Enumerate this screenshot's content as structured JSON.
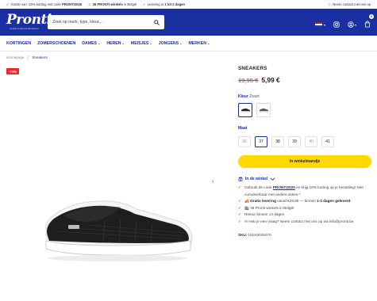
{
  "topbar": {
    "items": [
      {
        "pre": "Gratis! van -10% korting met code ",
        "bold": "PRONTI2026",
        "post": ""
      },
      {
        "pre": "",
        "bold": "36 PRONTI-winkels",
        "post": " in België"
      },
      {
        "pre": "Levering in ",
        "bold": "1 tot 2 dagen",
        "post": ""
      }
    ],
    "contact": "Neem contact met ons op"
  },
  "header": {
    "logo_text": "Pronti",
    "logo_tagline": "Comfort & Stijl voor Elk Moment",
    "search_placeholder": "Zoek op merk, type, kleur,...",
    "cart_count": "0"
  },
  "nav": {
    "items": [
      {
        "label": "KORTINGEN",
        "dropdown": false
      },
      {
        "label": "ZOMERSCHOENEN",
        "dropdown": false
      },
      {
        "label": "DAMES",
        "dropdown": true
      },
      {
        "label": "HEREN",
        "dropdown": true
      },
      {
        "label": "MEISJES",
        "dropdown": true
      },
      {
        "label": "JONGENS",
        "dropdown": true
      },
      {
        "label": "MERKEN",
        "dropdown": true
      }
    ]
  },
  "breadcrumb": {
    "home": "Homepage",
    "sep": "/",
    "current": "Sneakers"
  },
  "product": {
    "badge": "-70%",
    "title": "SNEAKERS",
    "old_price": "19,95 €",
    "new_price": "5,99 €",
    "color_label": "Kleur",
    "color_value": "Zwart",
    "size_label": "Maat",
    "sizes": [
      {
        "label": "36",
        "state": "unavailable"
      },
      {
        "label": "37",
        "state": "selected"
      },
      {
        "label": "38",
        "state": "available"
      },
      {
        "label": "39",
        "state": "available"
      },
      {
        "label": "40",
        "state": "unavailable"
      },
      {
        "label": "41",
        "state": "available"
      }
    ],
    "cta_label": "In winkelmandje",
    "store_label": "In de winkel",
    "usps": [
      {
        "parts": [
          {
            "t": "Gebruik de code "
          },
          {
            "t": "PRONTI2025",
            "link": true
          },
          {
            "t": " en krijg 10% korting op je bestelling! Niet cumuleerbaar met andere acties.*"
          }
        ]
      },
      {
        "parts": [
          {
            "t": "Gratis levering",
            "b": true
          },
          {
            "t": " vanaf €29,95 — binnen "
          },
          {
            "t": "1-2 dagen geleverd",
            "b": true
          }
        ]
      },
      {
        "parts": [
          {
            "t": "38 Pronti-winkels in België"
          }
        ]
      },
      {
        "parts": [
          {
            "t": "Retour binnen 14 dagen"
          }
        ]
      },
      {
        "parts": [
          {
            "t": "Heb je een vraag? Neem contact met ons op via info@pronti.be"
          }
        ]
      }
    ],
    "sku_label": "SKU:",
    "sku_value": "191XS025370"
  },
  "colors": {
    "brand": "#1a2fa0",
    "accent": "#ffd800",
    "sale": "#e32b2b",
    "check": "#2a9d3a"
  }
}
